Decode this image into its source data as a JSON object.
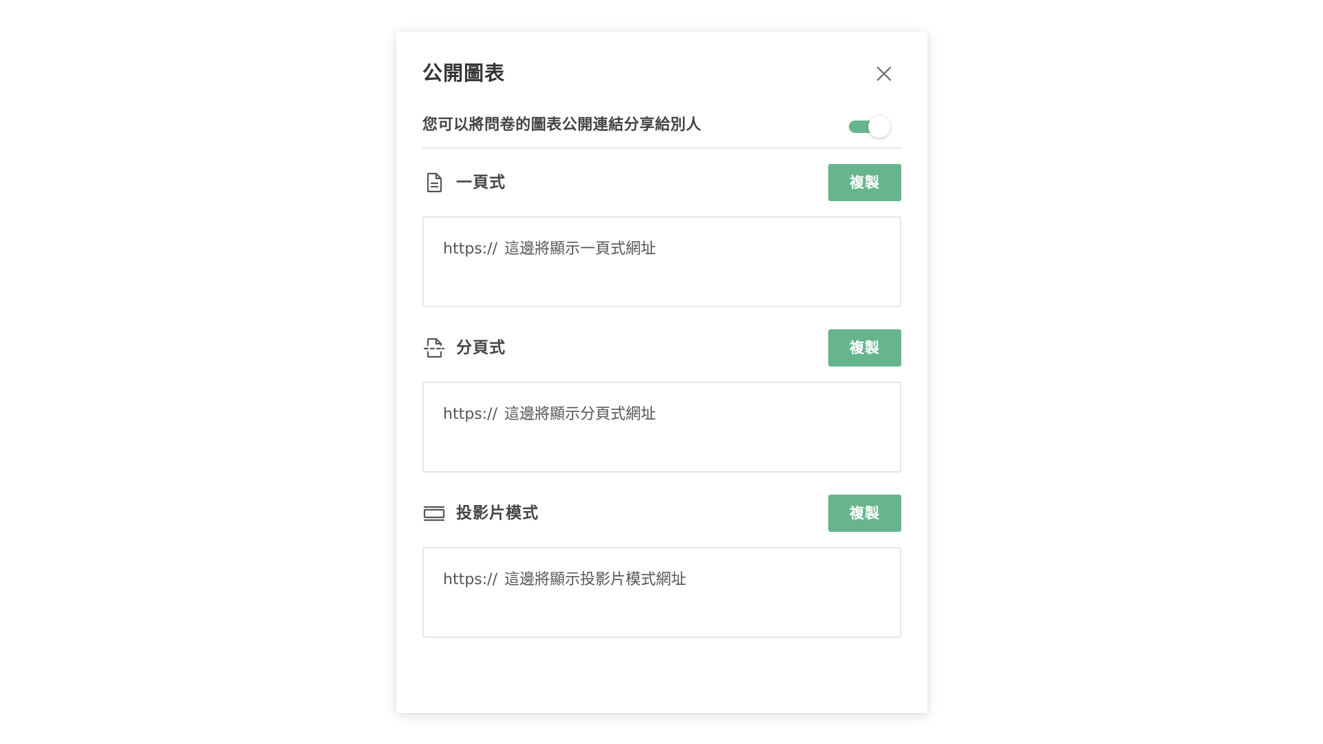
{
  "dialog": {
    "title": "公開圖表",
    "close_icon": "close-icon"
  },
  "share_toggle": {
    "label": "您可以將問卷的圖表公開連結分享給別人",
    "enabled": true,
    "color": "#66b58d"
  },
  "sections": [
    {
      "icon": "document-icon",
      "label": "一頁式",
      "copy_label": "複製",
      "url_prefix": "https://",
      "url_text": "這邊將顯示一頁式網址"
    },
    {
      "icon": "page-break-icon",
      "label": "分頁式",
      "copy_label": "複製",
      "url_prefix": "https://",
      "url_text": "這邊將顯示分頁式網址"
    },
    {
      "icon": "slideshow-icon",
      "label": "投影片模式",
      "copy_label": "複製",
      "url_prefix": "https://",
      "url_text": "這邊將顯示投影片模式網址"
    }
  ],
  "colors": {
    "accent": "#66b58d",
    "text": "#444444",
    "border": "#e6e6e6"
  }
}
